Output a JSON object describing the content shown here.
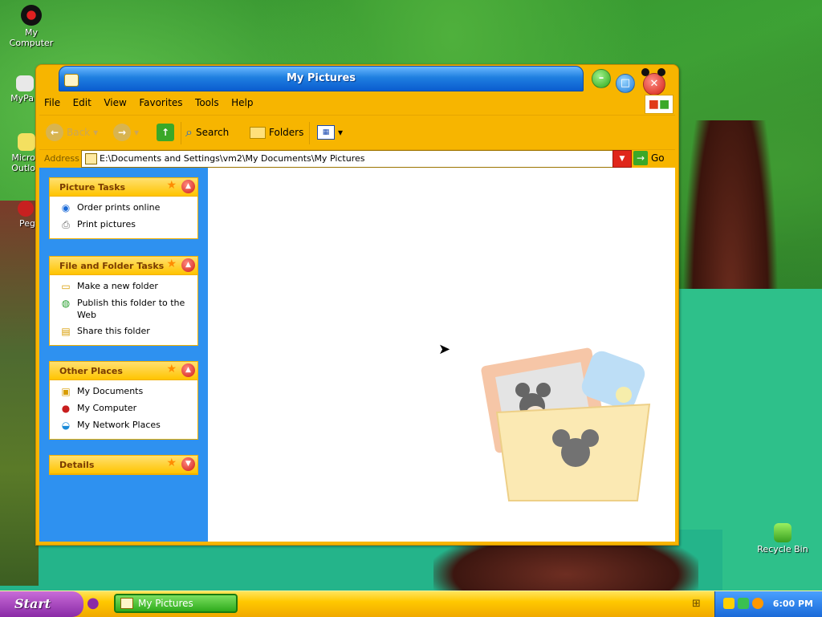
{
  "desktop": {
    "icons": [
      {
        "label": "My Computer"
      },
      {
        "label": "MyPa"
      },
      {
        "label": "Micro Outlo"
      },
      {
        "label": "Peg"
      },
      {
        "label": "Recycle Bin"
      }
    ]
  },
  "window": {
    "title": "My Pictures",
    "menu": [
      "File",
      "Edit",
      "View",
      "Favorites",
      "Tools",
      "Help"
    ],
    "toolbar": {
      "back_label": "Back",
      "search_label": "Search",
      "folders_label": "Folders"
    },
    "address": {
      "label": "Address",
      "value": "E:\\Documents and Settings\\vm2\\My Documents\\My Pictures",
      "go_label": "Go"
    },
    "panels": {
      "picture_tasks": {
        "title": "Picture Tasks",
        "items": [
          "Order prints online",
          "Print pictures"
        ]
      },
      "file_folder_tasks": {
        "title": "File and Folder Tasks",
        "items": [
          "Make a new folder",
          "Publish this folder to the Web",
          "Share this folder"
        ]
      },
      "other_places": {
        "title": "Other Places",
        "items": [
          "My Documents",
          "My Computer",
          "My Network Places"
        ]
      },
      "details": {
        "title": "Details"
      }
    }
  },
  "taskbar": {
    "start_label": "Start",
    "task_button": "My Pictures",
    "clock": "6:00 PM"
  },
  "colors": {
    "window_frame": "#f7b500",
    "titlebar": "#1f7fe0",
    "task_pane": "#2e91f0",
    "taskbar": "#ffc800",
    "start_button": "#8a2aa6"
  }
}
